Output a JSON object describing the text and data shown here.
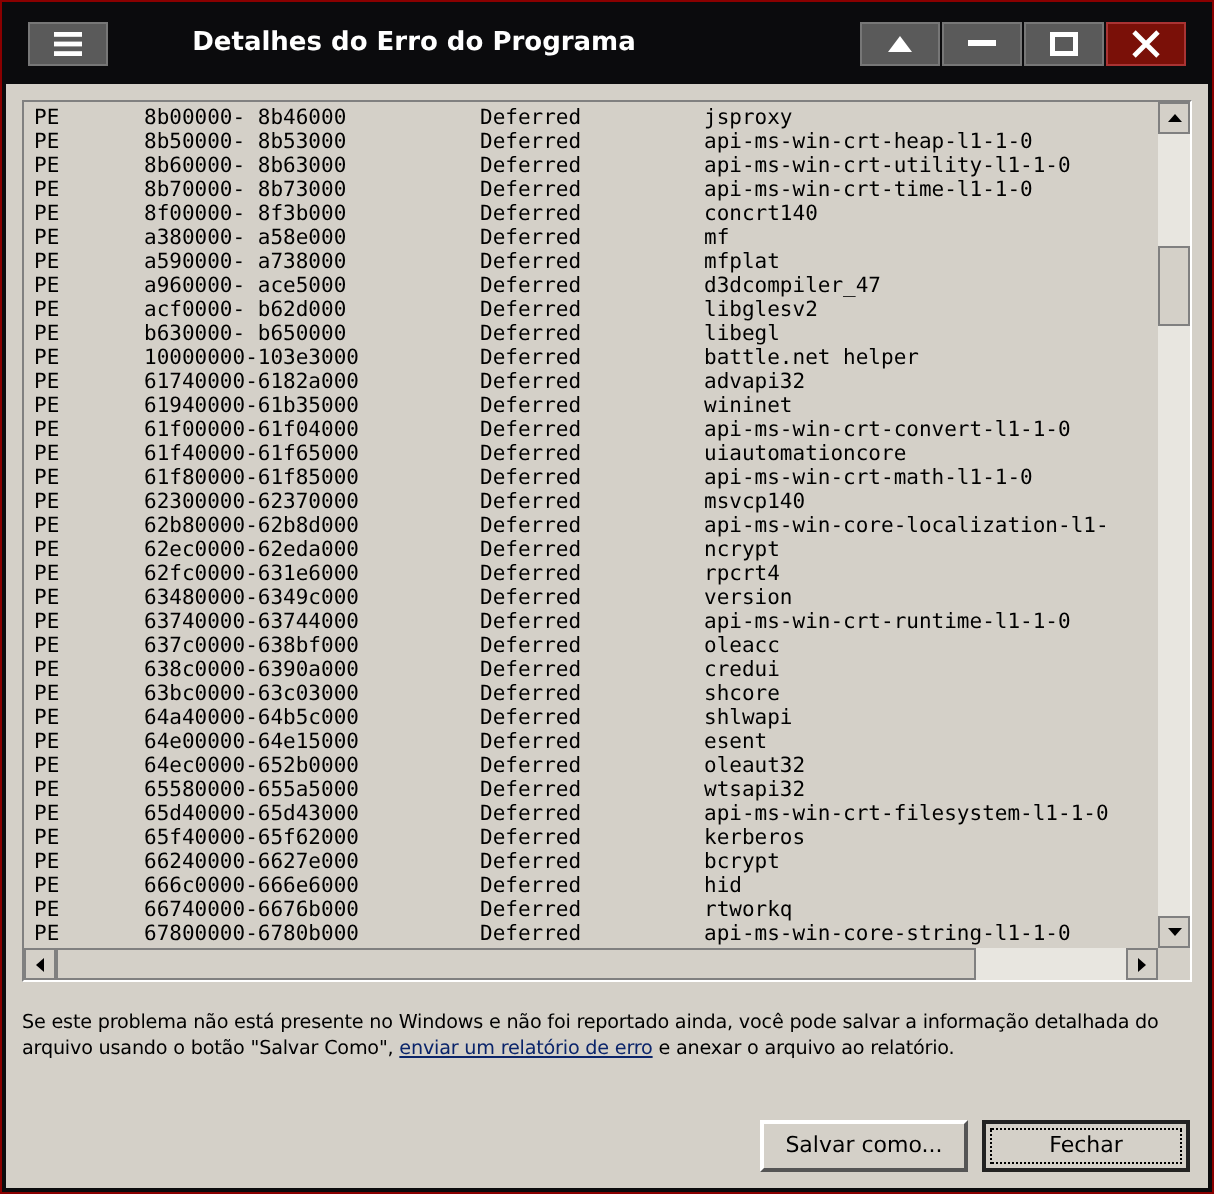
{
  "window": {
    "title": "Detalhes do Erro do Programa"
  },
  "modules": [
    {
      "type": "PE",
      "range": "8b00000- 8b46000",
      "status": "Deferred",
      "name": "jsproxy"
    },
    {
      "type": "PE",
      "range": "8b50000- 8b53000",
      "status": "Deferred",
      "name": "api-ms-win-crt-heap-l1-1-0"
    },
    {
      "type": "PE",
      "range": "8b60000- 8b63000",
      "status": "Deferred",
      "name": "api-ms-win-crt-utility-l1-1-0"
    },
    {
      "type": "PE",
      "range": "8b70000- 8b73000",
      "status": "Deferred",
      "name": "api-ms-win-crt-time-l1-1-0"
    },
    {
      "type": "PE",
      "range": "8f00000- 8f3b000",
      "status": "Deferred",
      "name": "concrt140"
    },
    {
      "type": "PE",
      "range": "a380000- a58e000",
      "status": "Deferred",
      "name": "mf"
    },
    {
      "type": "PE",
      "range": "a590000- a738000",
      "status": "Deferred",
      "name": "mfplat"
    },
    {
      "type": "PE",
      "range": "a960000- ace5000",
      "status": "Deferred",
      "name": "d3dcompiler_47"
    },
    {
      "type": "PE",
      "range": "acf0000- b62d000",
      "status": "Deferred",
      "name": "libglesv2"
    },
    {
      "type": "PE",
      "range": "b630000- b650000",
      "status": "Deferred",
      "name": "libegl"
    },
    {
      "type": "PE",
      "range": "10000000-103e3000",
      "status": "Deferred",
      "name": "battle.net helper"
    },
    {
      "type": "PE",
      "range": "61740000-6182a000",
      "status": "Deferred",
      "name": "advapi32"
    },
    {
      "type": "PE",
      "range": "61940000-61b35000",
      "status": "Deferred",
      "name": "wininet"
    },
    {
      "type": "PE",
      "range": "61f00000-61f04000",
      "status": "Deferred",
      "name": "api-ms-win-crt-convert-l1-1-0"
    },
    {
      "type": "PE",
      "range": "61f40000-61f65000",
      "status": "Deferred",
      "name": "uiautomationcore"
    },
    {
      "type": "PE",
      "range": "61f80000-61f85000",
      "status": "Deferred",
      "name": "api-ms-win-crt-math-l1-1-0"
    },
    {
      "type": "PE",
      "range": "62300000-62370000",
      "status": "Deferred",
      "name": "msvcp140"
    },
    {
      "type": "PE",
      "range": "62b80000-62b8d000",
      "status": "Deferred",
      "name": "api-ms-win-core-localization-l1-"
    },
    {
      "type": "PE",
      "range": "62ec0000-62eda000",
      "status": "Deferred",
      "name": "ncrypt"
    },
    {
      "type": "PE",
      "range": "62fc0000-631e6000",
      "status": "Deferred",
      "name": "rpcrt4"
    },
    {
      "type": "PE",
      "range": "63480000-6349c000",
      "status": "Deferred",
      "name": "version"
    },
    {
      "type": "PE",
      "range": "63740000-63744000",
      "status": "Deferred",
      "name": "api-ms-win-crt-runtime-l1-1-0"
    },
    {
      "type": "PE",
      "range": "637c0000-638bf000",
      "status": "Deferred",
      "name": "oleacc"
    },
    {
      "type": "PE",
      "range": "638c0000-6390a000",
      "status": "Deferred",
      "name": "credui"
    },
    {
      "type": "PE",
      "range": "63bc0000-63c03000",
      "status": "Deferred",
      "name": "shcore"
    },
    {
      "type": "PE",
      "range": "64a40000-64b5c000",
      "status": "Deferred",
      "name": "shlwapi"
    },
    {
      "type": "PE",
      "range": "64e00000-64e15000",
      "status": "Deferred",
      "name": "esent"
    },
    {
      "type": "PE",
      "range": "64ec0000-652b0000",
      "status": "Deferred",
      "name": "oleaut32"
    },
    {
      "type": "PE",
      "range": "65580000-655a5000",
      "status": "Deferred",
      "name": "wtsapi32"
    },
    {
      "type": "PE",
      "range": "65d40000-65d43000",
      "status": "Deferred",
      "name": "api-ms-win-crt-filesystem-l1-1-0"
    },
    {
      "type": "PE",
      "range": "65f40000-65f62000",
      "status": "Deferred",
      "name": "kerberos"
    },
    {
      "type": "PE",
      "range": "66240000-6627e000",
      "status": "Deferred",
      "name": "bcrypt"
    },
    {
      "type": "PE",
      "range": "666c0000-666e6000",
      "status": "Deferred",
      "name": "hid"
    },
    {
      "type": "PE",
      "range": "66740000-6676b000",
      "status": "Deferred",
      "name": "rtworkq"
    },
    {
      "type": "PE",
      "range": "67800000-6780b000",
      "status": "Deferred",
      "name": "api-ms-win-core-string-l1-1-0"
    }
  ],
  "message": {
    "before": "Se este problema não está presente no Windows e não foi reportado ainda, você pode salvar a informação detalhada do arquivo usando o botão \"Salvar Como\",",
    "link": "enviar um relatório de erro",
    "after": "e anexar o arquivo ao relatório."
  },
  "buttons": [
    "Salvar como...",
    "Fechar"
  ]
}
